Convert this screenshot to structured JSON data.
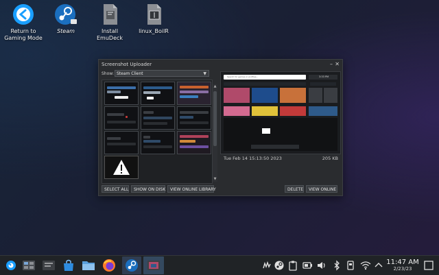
{
  "desktop": {
    "icons": [
      {
        "label_line1": "Return to",
        "label_line2": "Gaming Mode"
      },
      {
        "label": "Steam"
      },
      {
        "label": "Install EmuDeck"
      },
      {
        "label": "linux_BoilR"
      }
    ]
  },
  "window": {
    "title": "Screenshot Uploader",
    "show_label": "Show:",
    "show_value": "Steam Client",
    "preview": {
      "search_placeholder": "Search for games or profiles...",
      "clock": "3:33 PM"
    },
    "timestamp": "Tue Feb 14 15:13:50 2023",
    "filesize": "205 KB",
    "buttons": {
      "select_all": "SELECT ALL",
      "show_on_disk": "SHOW ON DISK",
      "view_online_library": "VIEW ONLINE LIBRARY",
      "delete": "DELETE",
      "view_online": "VIEW ONLINE"
    }
  },
  "taskbar": {
    "clock": {
      "time": "11:47 AM",
      "date": "2/23/23"
    }
  },
  "colors": {
    "steam_blue": "#1a9fff",
    "window_bg": "#2a2c2f",
    "taskbar_bg": "#202326"
  }
}
